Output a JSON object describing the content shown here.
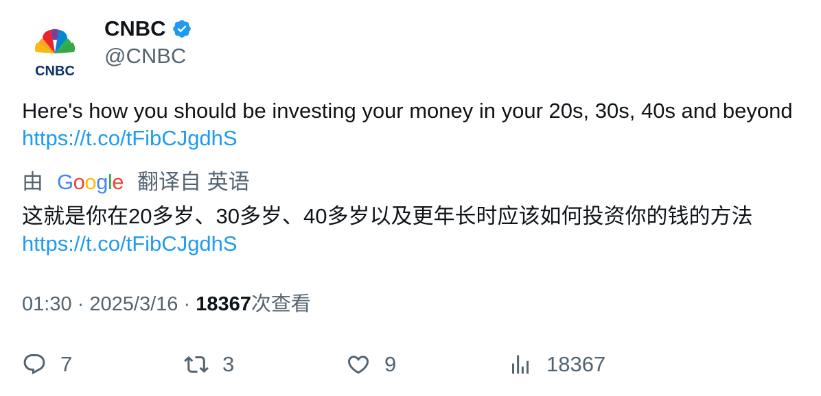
{
  "account": {
    "display_name": "CNBC",
    "handle": "@CNBC",
    "verified": true,
    "logo_text": "CNBC"
  },
  "tweet": {
    "text": "Here's how you should be investing your money in your 20s, 30s, 40s and beyond ",
    "link": "https://t.co/tFibCJgdhS"
  },
  "translation": {
    "prefix": "由",
    "provider": "Google",
    "suffix": "翻译自 英语",
    "text": "这就是你在20多岁、30多岁、40多岁以及更年长时应该如何投资你的钱的方法",
    "link": "https://t.co/tFibCJgdhS"
  },
  "meta": {
    "time": "01:30",
    "separator": "·",
    "date": "2025/3/16",
    "views_count": "18367",
    "views_label": "次查看"
  },
  "actions": {
    "replies": "7",
    "retweets": "3",
    "likes": "9",
    "views": "18367"
  },
  "colors": {
    "link": "#1d9bf0",
    "secondary": "#536471",
    "verified": "#1d9bf0"
  }
}
